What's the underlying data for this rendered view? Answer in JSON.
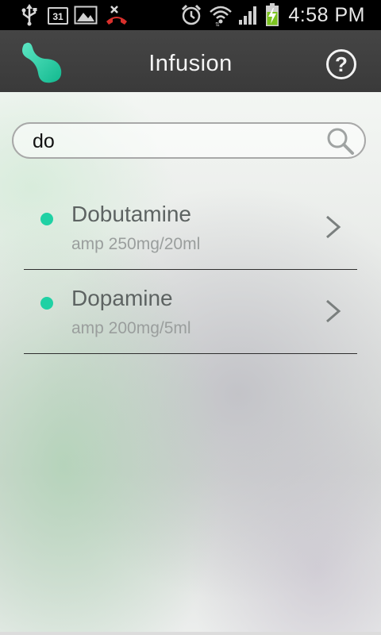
{
  "status_bar": {
    "calendar_day": "31",
    "time": "4:58 PM",
    "icons": [
      "usb-icon",
      "calendar-icon",
      "gallery-icon",
      "missed-call-icon",
      "alarm-icon",
      "wifi-icon",
      "signal-icon",
      "battery-charging-icon"
    ]
  },
  "header": {
    "title": "Infusion",
    "help_label": "?",
    "logo_icon": "app-logo-icon"
  },
  "search": {
    "value": "do",
    "icon": "search-icon"
  },
  "results": [
    {
      "name": "Dobutamine",
      "dose": "amp 250mg/20ml"
    },
    {
      "name": "Dopamine",
      "dose": "amp 200mg/5ml"
    }
  ],
  "colors": {
    "accent": "#1fd1a4",
    "titlebar": "#3f3f3f",
    "statusbar": "#000000"
  }
}
